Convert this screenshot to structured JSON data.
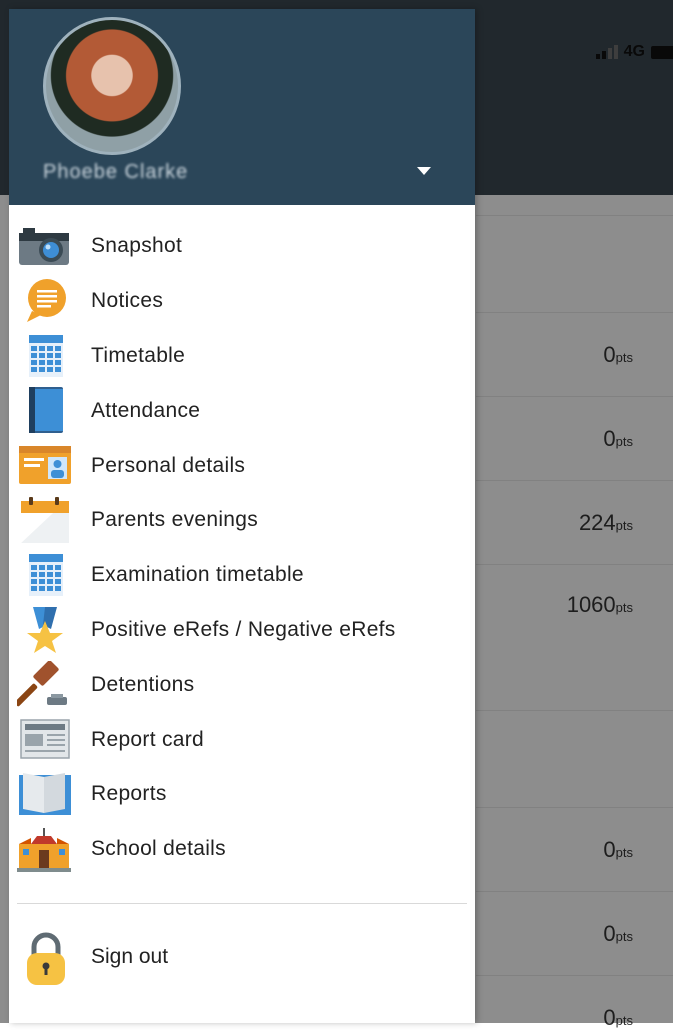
{
  "status_bar": {
    "network": "4G"
  },
  "drawer": {
    "user_name": "Phoebe Clarke",
    "menu": [
      {
        "label": "Snapshot",
        "icon": "camera-icon"
      },
      {
        "label": "Notices",
        "icon": "notice-bubble-icon"
      },
      {
        "label": "Timetable",
        "icon": "calendar-icon"
      },
      {
        "label": "Attendance",
        "icon": "register-book-icon"
      },
      {
        "label": "Personal details",
        "icon": "id-card-icon"
      },
      {
        "label": "Parents evenings",
        "icon": "planner-icon"
      },
      {
        "label": "Examination timetable",
        "icon": "exam-calendar-icon"
      },
      {
        "label": "Positive eRefs / Negative eRefs",
        "icon": "medal-star-icon"
      },
      {
        "label": "Detentions",
        "icon": "gavel-icon"
      },
      {
        "label": "Report card",
        "icon": "newspaper-icon"
      },
      {
        "label": "Reports",
        "icon": "open-book-icon"
      },
      {
        "label": "School details",
        "icon": "school-building-icon"
      }
    ],
    "sign_out": {
      "label": "Sign out",
      "icon": "padlock-icon"
    }
  },
  "background_points": [
    {
      "value": "0",
      "unit": "pts"
    },
    {
      "value": "0",
      "unit": "pts"
    },
    {
      "value": "224",
      "unit": "pts"
    },
    {
      "value": "1060",
      "unit": "pts"
    },
    {
      "value": "0",
      "unit": "pts"
    },
    {
      "value": "0",
      "unit": "pts"
    },
    {
      "value": "0",
      "unit": "pts"
    }
  ],
  "colors": {
    "drawer_header": "#2b4659",
    "app_header": "#3a464e",
    "accent_blue": "#3d8fd6",
    "accent_orange": "#f0a12b"
  }
}
